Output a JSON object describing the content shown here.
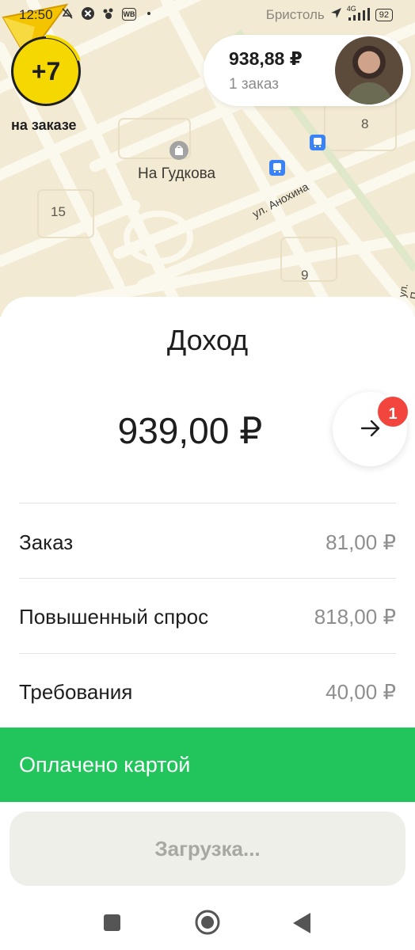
{
  "status_bar": {
    "time": "12:50",
    "city": "Бристоль",
    "network": "4G",
    "battery": "92",
    "icons": [
      "silent-icon",
      "x-circle-icon",
      "paw-icon",
      "wb-app-icon"
    ]
  },
  "map": {
    "place_name": "На Гудкова",
    "street_name": "ул. Анохина",
    "street_name_edge": "ул. П",
    "building_numbers": [
      "8",
      "15",
      "9"
    ],
    "icons": [
      "shopping-bag-icon",
      "bus-stop-icon",
      "navigation-arrow-icon"
    ]
  },
  "counter": {
    "value": "+7",
    "caption": "на заказе",
    "progress_fraction": 0.2
  },
  "balance": {
    "amount": "938,88 ₽",
    "orders": "1 заказ"
  },
  "sheet": {
    "title": "Доход",
    "total": "939,00 ₽",
    "notification_count": "1",
    "rows": [
      {
        "label": "Заказ",
        "value": "81,00 ₽"
      },
      {
        "label": "Повышенный спрос",
        "value": "818,00 ₽"
      },
      {
        "label": "Требования",
        "value": "40,00 ₽"
      }
    ],
    "payment_status": "Оплачено картой",
    "loading_button": "Загрузка..."
  },
  "colors": {
    "accent_yellow": "#f5d800",
    "paid_green": "#21c55b",
    "badge_red": "#f2453d",
    "map_bg": "#f2ead2"
  }
}
